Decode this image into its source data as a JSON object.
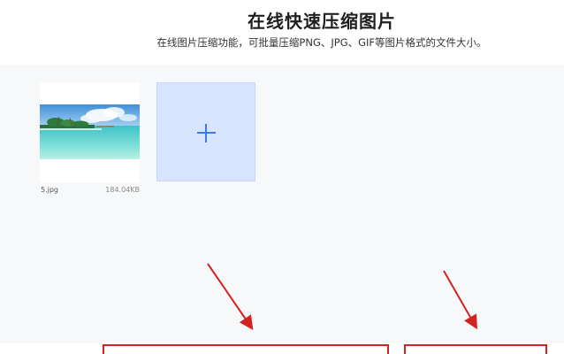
{
  "header": {
    "title": "在线快速压缩图片",
    "subtitle": "在线图片压缩功能，可批量压缩PNG、JPG、GIF等图片格式的文件大小。"
  },
  "files": [
    {
      "name": "5.jpg",
      "size": "184.04KB"
    }
  ],
  "add_tile": {
    "icon": "plus-icon"
  },
  "colors": {
    "accent": "#3a7cf0",
    "add_tile_bg": "#d6e4fd",
    "work_area_bg": "#f7f8fa",
    "annotation_red": "#d22222"
  }
}
